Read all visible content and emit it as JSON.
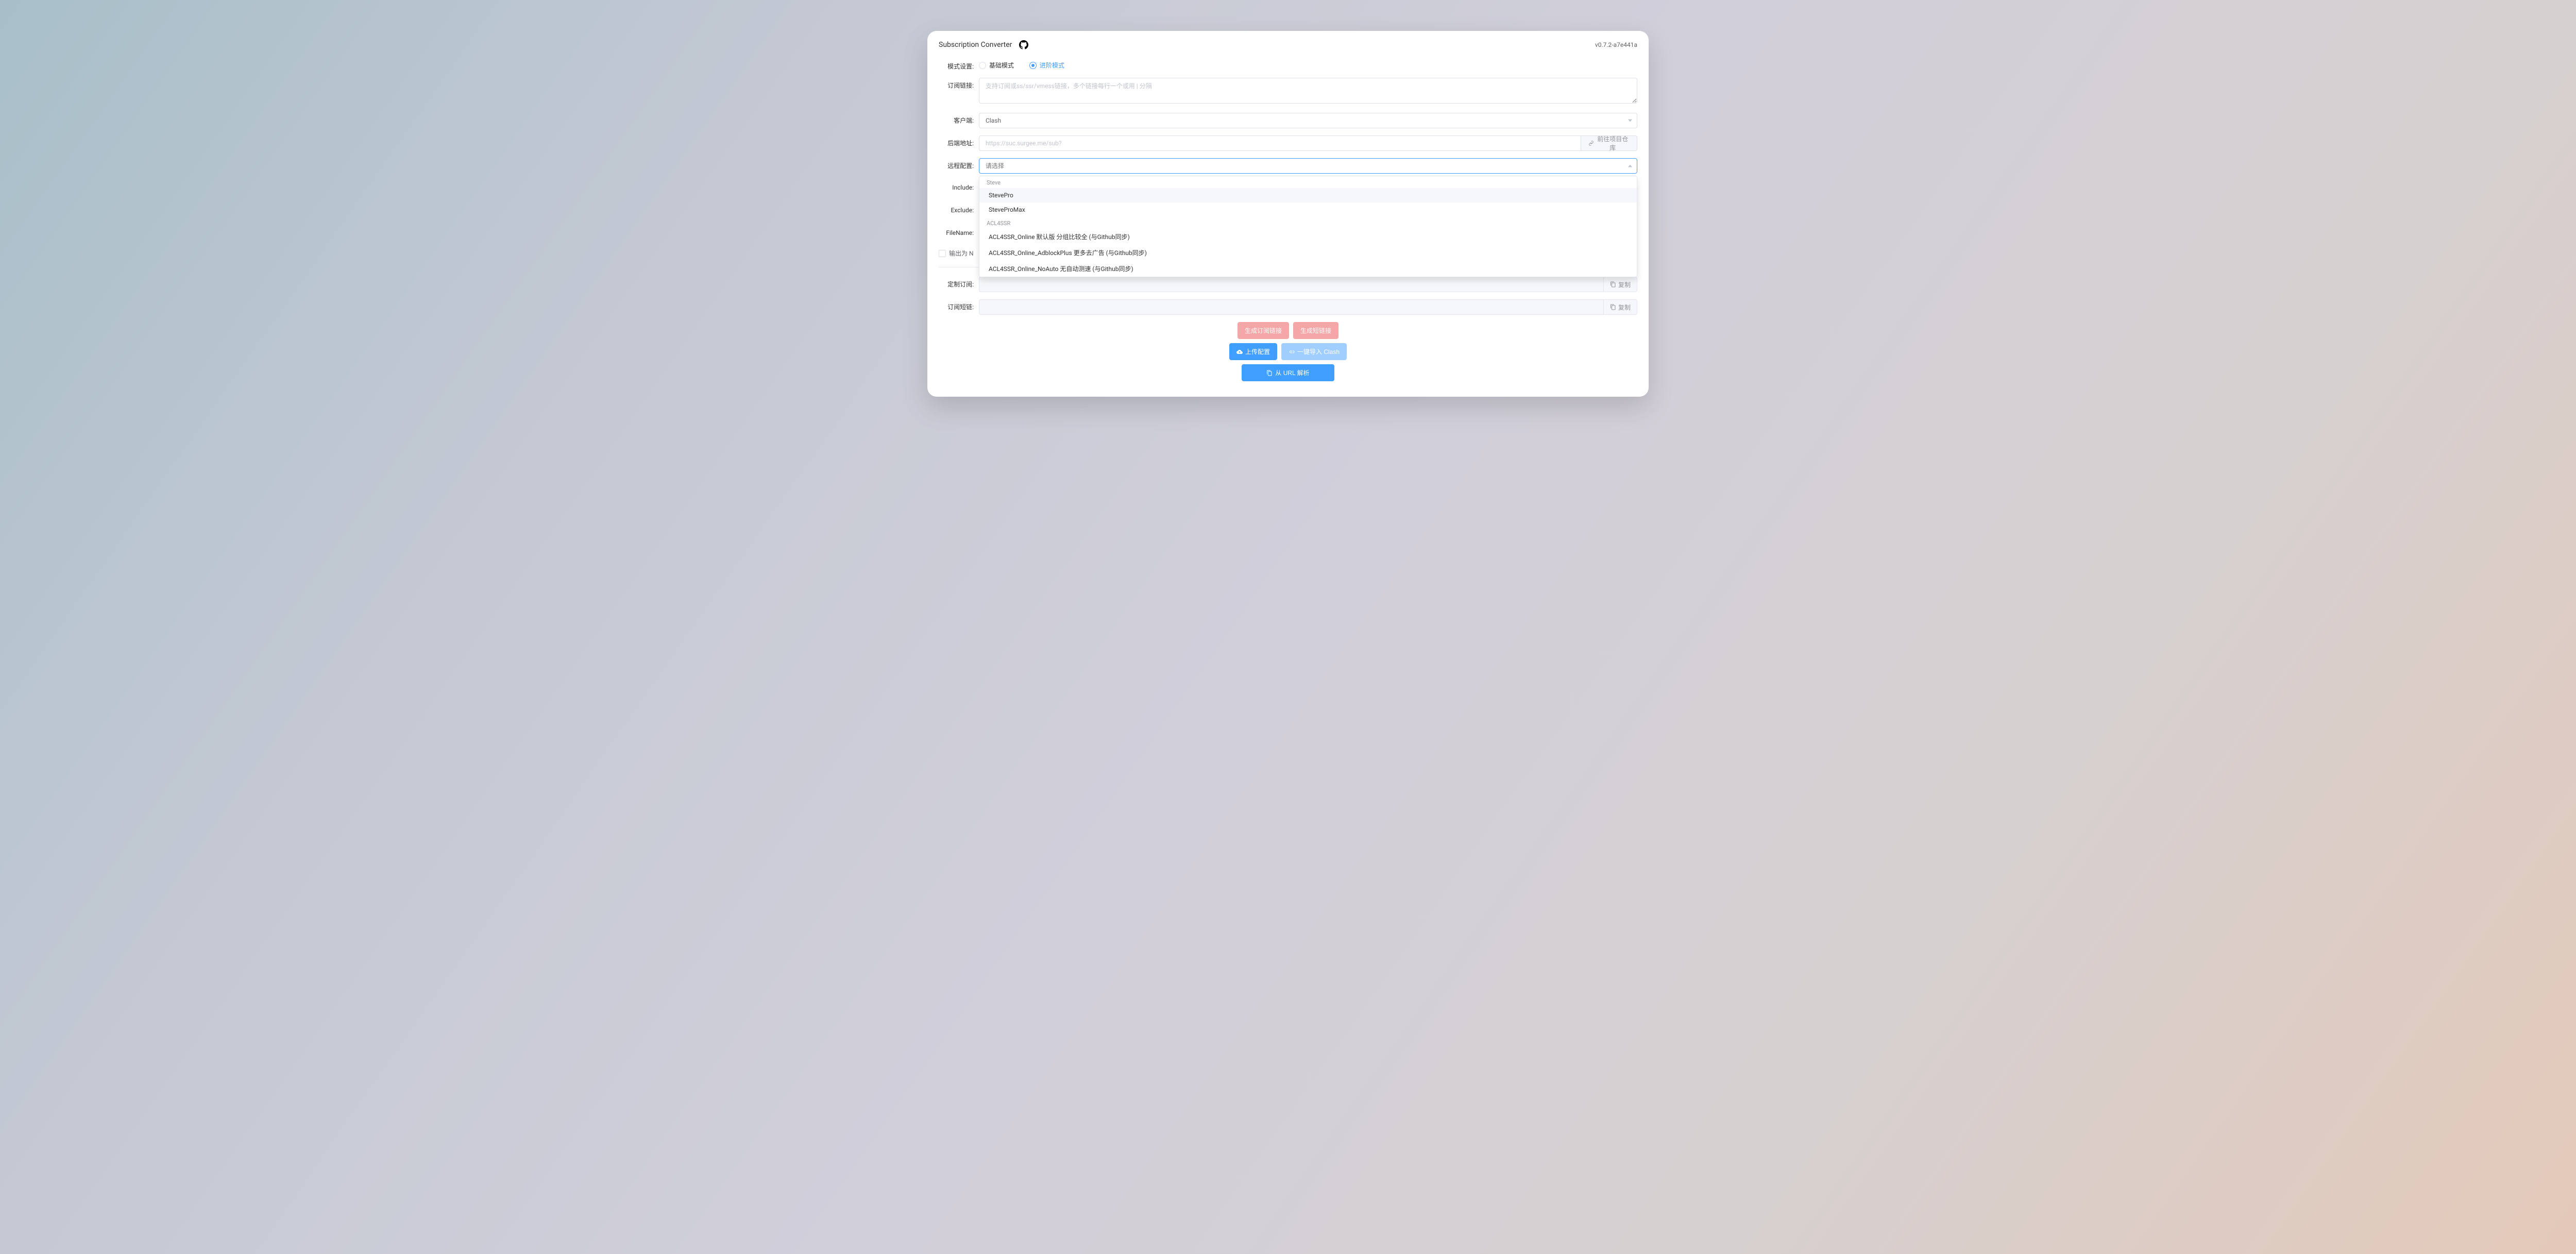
{
  "header": {
    "title": "Subscription Converter",
    "version": "v0.7.2-a7e441a"
  },
  "labels": {
    "mode": "模式设置:",
    "sublink": "订阅链接:",
    "client": "客户端:",
    "backend": "后端地址:",
    "remote": "远程配置:",
    "include": "Include:",
    "exclude": "Exclude:",
    "filename": "FileName:",
    "custom_sub": "定制订阅:",
    "short_url": "订阅短链:"
  },
  "mode_options": {
    "basic": "基础模式",
    "advanced": "进阶模式"
  },
  "placeholders": {
    "sublink": "支持订阅或ss/ssr/vmess链接，多个链接每行一个或用 | 分隔",
    "backend": "https://suc.surgee.me/sub?",
    "remote": "请选择"
  },
  "client_selected": "Clash",
  "backend_btn": "前往项目仓库",
  "checkbox_label": "输出为 N",
  "copy_label": "复制",
  "dropdown": {
    "groups": [
      {
        "label": "Steve",
        "items": [
          "StevePro",
          "SteveProMax"
        ]
      },
      {
        "label": "ACL4SSR",
        "items": [
          "ACL4SSR_Online 默认版 分组比较全 (与Github同步)",
          "ACL4SSR_Online_AdblockPlus 更多去广告 (与Github同步)",
          "ACL4SSR_Online_NoAuto 无自动测速 (与Github同步)"
        ]
      }
    ]
  },
  "buttons": {
    "gen_sub": "生成订阅链接",
    "gen_short": "生成短链接",
    "upload": "上传配置",
    "import_clash": "一键导入 Clash",
    "parse_url": "从 URL 解析"
  }
}
